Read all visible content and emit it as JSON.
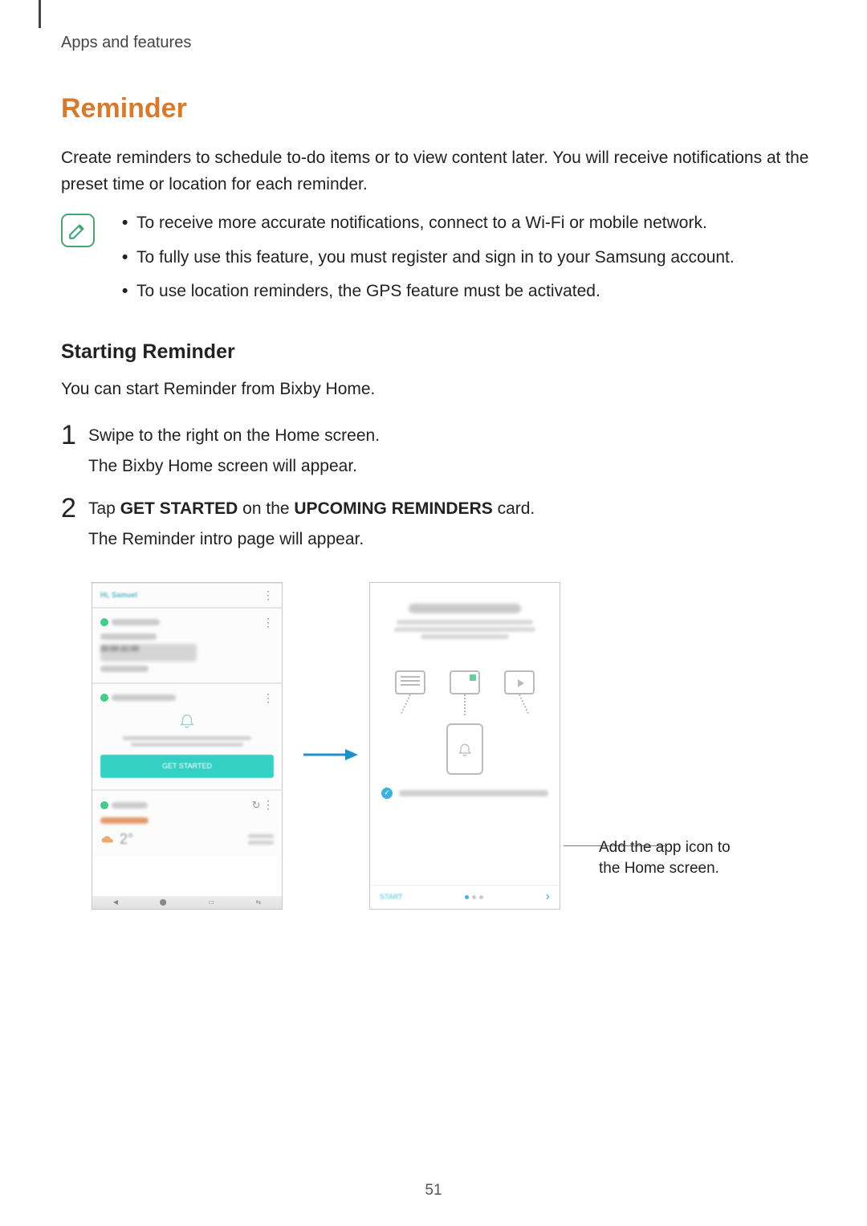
{
  "header": {
    "section": "Apps and features"
  },
  "title": "Reminder",
  "intro": "Create reminders to schedule to-do items or to view content later. You will receive notifications at the preset time or location for each reminder.",
  "notes": [
    "To receive more accurate notifications, connect to a Wi-Fi or mobile network.",
    "To fully use this feature, you must register and sign in to your Samsung account.",
    "To use location reminders, the GPS feature must be activated."
  ],
  "subheading": "Starting Reminder",
  "sub_para": "You can start Reminder from Bixby Home.",
  "steps": {
    "s1_num": "1",
    "s1_a": "Swipe to the right on the Home screen.",
    "s1_b": "The Bixby Home screen will appear.",
    "s2_num": "2",
    "s2_pre": "Tap ",
    "s2_b1": "GET STARTED",
    "s2_mid": " on the ",
    "s2_b2": "UPCOMING REMINDERS",
    "s2_post": " card.",
    "s2_b": "The Reminder intro page will appear."
  },
  "callout": "Add the app icon to the Home screen.",
  "left_shot": {
    "time_blur": "20:00-21:00",
    "btn": "GET STARTED",
    "temp": "2°"
  },
  "page": "51"
}
